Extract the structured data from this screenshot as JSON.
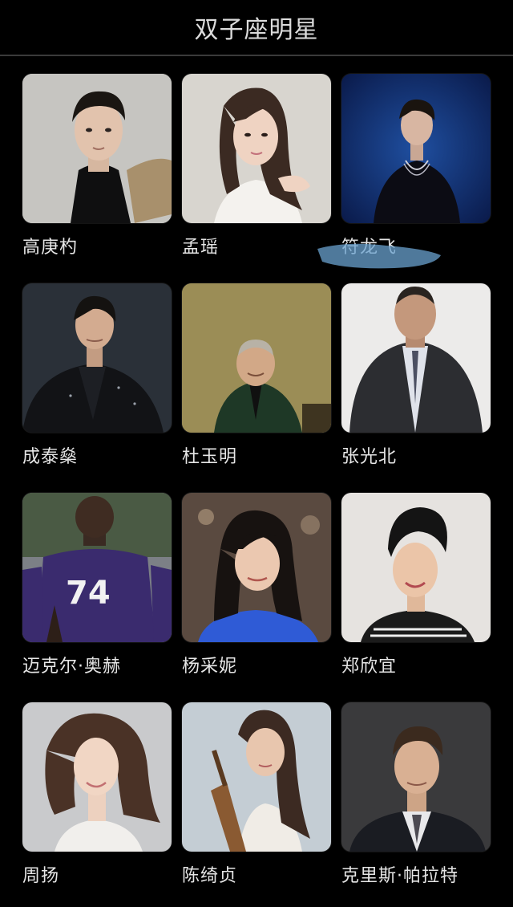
{
  "header": {
    "title": "双子座明星"
  },
  "stars": [
    {
      "name": "高庚杓",
      "photo": "portrait-gray-bg-black-turtleneck"
    },
    {
      "name": "孟瑶",
      "photo": "portrait-light-bg-white-shirt"
    },
    {
      "name": "符龙飞",
      "photo": "portrait-blue-bg-dark-jacket"
    },
    {
      "name": "成泰燊",
      "photo": "portrait-dark-bg-black-suit"
    },
    {
      "name": "杜玉明",
      "photo": "portrait-olive-bg-green-jacket"
    },
    {
      "name": "张光北",
      "photo": "portrait-light-bg-gray-suit"
    },
    {
      "name": "迈克尔·奥赫",
      "photo": "football-player-number-74"
    },
    {
      "name": "杨采妮",
      "photo": "portrait-warm-bg-blue-top"
    },
    {
      "name": "郑欣宜",
      "photo": "portrait-light-bg-striped-top"
    },
    {
      "name": "周扬",
      "photo": "portrait-gray-bg-white-dress"
    },
    {
      "name": "陈绮贞",
      "photo": "portrait-light-bg-guitar"
    },
    {
      "name": "克里斯·帕拉特",
      "photo": "portrait-dark-bg-suit-tie"
    }
  ],
  "jersey_number": "74"
}
